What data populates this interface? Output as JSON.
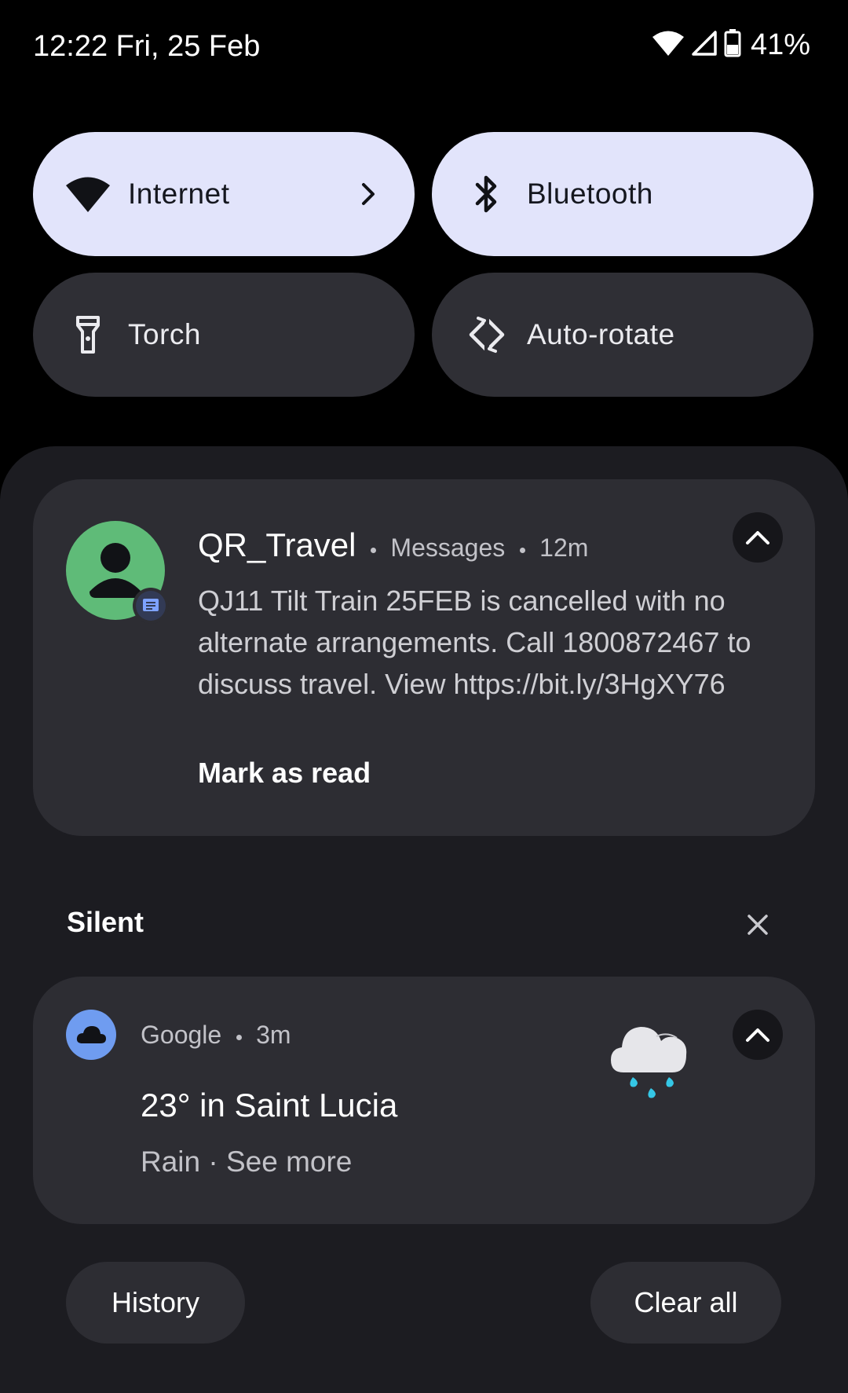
{
  "status_bar": {
    "time_date": "12:22 Fri, 25 Feb",
    "battery_percent": "41%",
    "icons": [
      "wifi-icon",
      "cellular-signal-icon",
      "battery-icon"
    ]
  },
  "quick_settings": {
    "tiles": [
      {
        "label": "Internet",
        "icon": "wifi-icon",
        "state": "on",
        "has_chevron": true
      },
      {
        "label": "Bluetooth",
        "icon": "bluetooth-icon",
        "state": "on"
      },
      {
        "label": "Torch",
        "icon": "flashlight-icon",
        "state": "off"
      },
      {
        "label": "Auto-rotate",
        "icon": "auto-rotate-icon",
        "state": "off"
      }
    ]
  },
  "notifications": {
    "message": {
      "sender": "QR_Travel",
      "app": "Messages",
      "time": "12m",
      "body": "QJ11 Tilt Train 25FEB is cancelled with no alternate arrangements. Call 1800872467 to discuss travel. View https://bit.ly/3HgXY76",
      "action": "Mark as read"
    },
    "silent_section": {
      "label": "Silent"
    },
    "weather": {
      "app": "Google",
      "time": "3m",
      "title": "23° in Saint Lucia",
      "subtitle": "Rain · See more"
    }
  },
  "footer": {
    "history_label": "History",
    "clear_all_label": "Clear all"
  },
  "colors": {
    "background": "#000000",
    "shade": "#1c1c21",
    "card": "#2d2d33",
    "tile_on": "#e2e4fb",
    "tile_off": "#2f2f35",
    "avatar": "#5fbb78",
    "google_icon_bg": "#6f9cf0",
    "rain_drop": "#35c7e6"
  }
}
